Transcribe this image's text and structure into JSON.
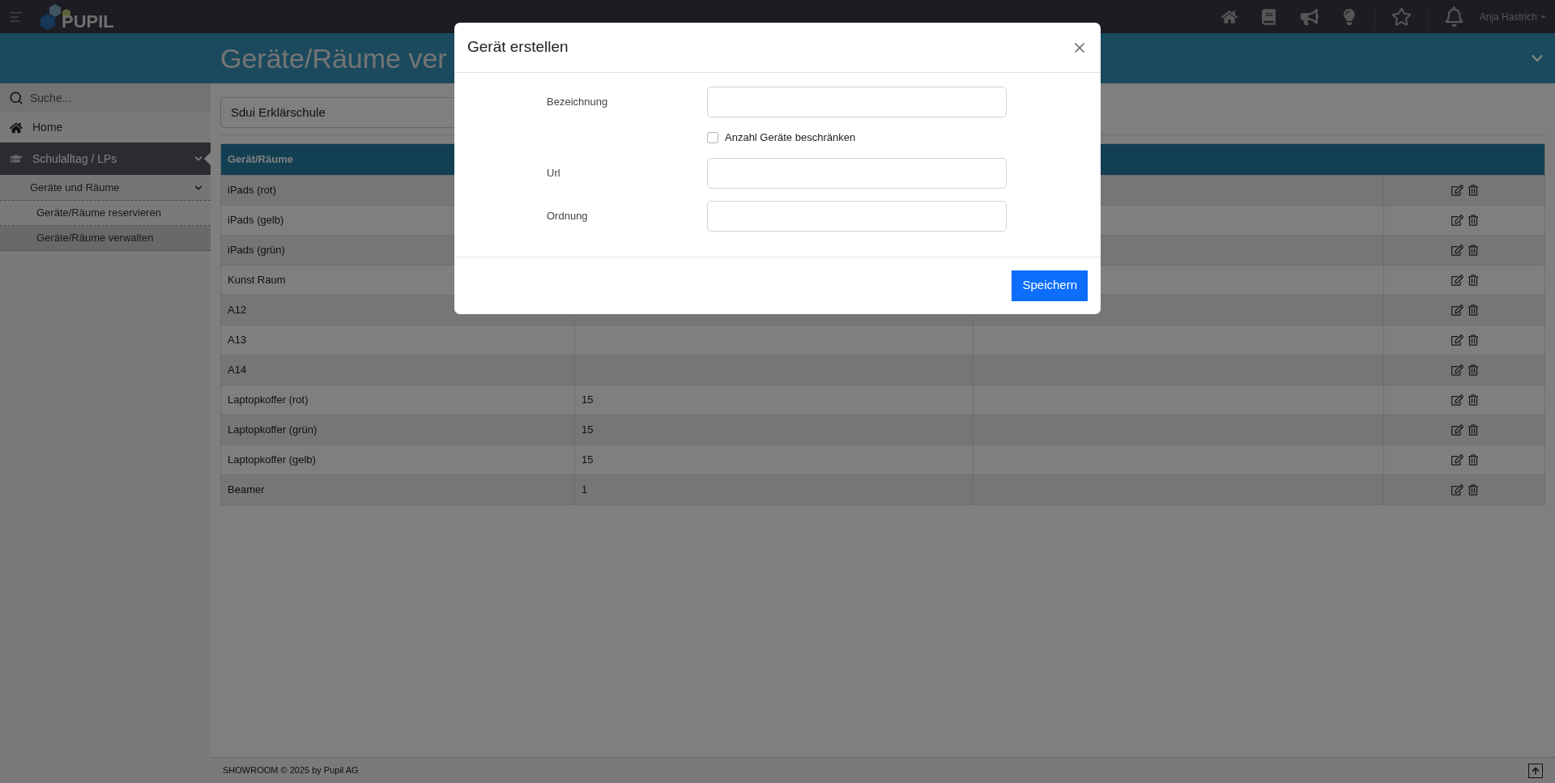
{
  "topbar": {
    "logo": "PUPIL",
    "user": "Anja Hastrich"
  },
  "header": {
    "title": "Geräte/Räume ver"
  },
  "sidebar": {
    "search": {
      "placeholder": "Suche..."
    },
    "items": [
      {
        "label": "Home",
        "selected": false
      },
      {
        "label": "Schulalltag / LPs",
        "selected": true,
        "expanded": true,
        "children": [
          {
            "label": "Geräte und Räume",
            "selected": false,
            "expanded": true,
            "children": [
              {
                "label": "Geräte/Räume reservieren",
                "selected": false
              },
              {
                "label": "Geräte/Räume verwalten",
                "selected": true
              }
            ]
          }
        ]
      }
    ]
  },
  "school_select": {
    "value": "Sdui Erklärschule"
  },
  "table": {
    "columns": [
      "Gerät/Räume"
    ],
    "rows": [
      {
        "name": "iPads (rot)"
      },
      {
        "name": "iPads (gelb)"
      },
      {
        "name": "iPads (grün)"
      },
      {
        "name": "Kunst Raum"
      },
      {
        "name": "A12"
      },
      {
        "name": "A13"
      },
      {
        "name": "A14"
      },
      {
        "name": "Laptopkoffer (rot)",
        "count": "15"
      },
      {
        "name": "Laptopkoffer (grün)",
        "count": "15"
      },
      {
        "name": "Laptopkoffer (gelb)",
        "count": "15"
      },
      {
        "name": "Beamer",
        "count": "1"
      }
    ]
  },
  "footer": {
    "text": "SHOWROOM © 2025 by Pupil AG"
  },
  "modal": {
    "title": "Gerät erstellen",
    "fields": [
      {
        "kind": "text",
        "label": "Bezeichnung"
      },
      {
        "kind": "checkbox",
        "label": "Anzahl Geräte beschränken",
        "checked": false
      },
      {
        "kind": "text",
        "label": "Url"
      },
      {
        "kind": "text",
        "label": "Ordnung"
      }
    ],
    "button": "Speichern"
  }
}
